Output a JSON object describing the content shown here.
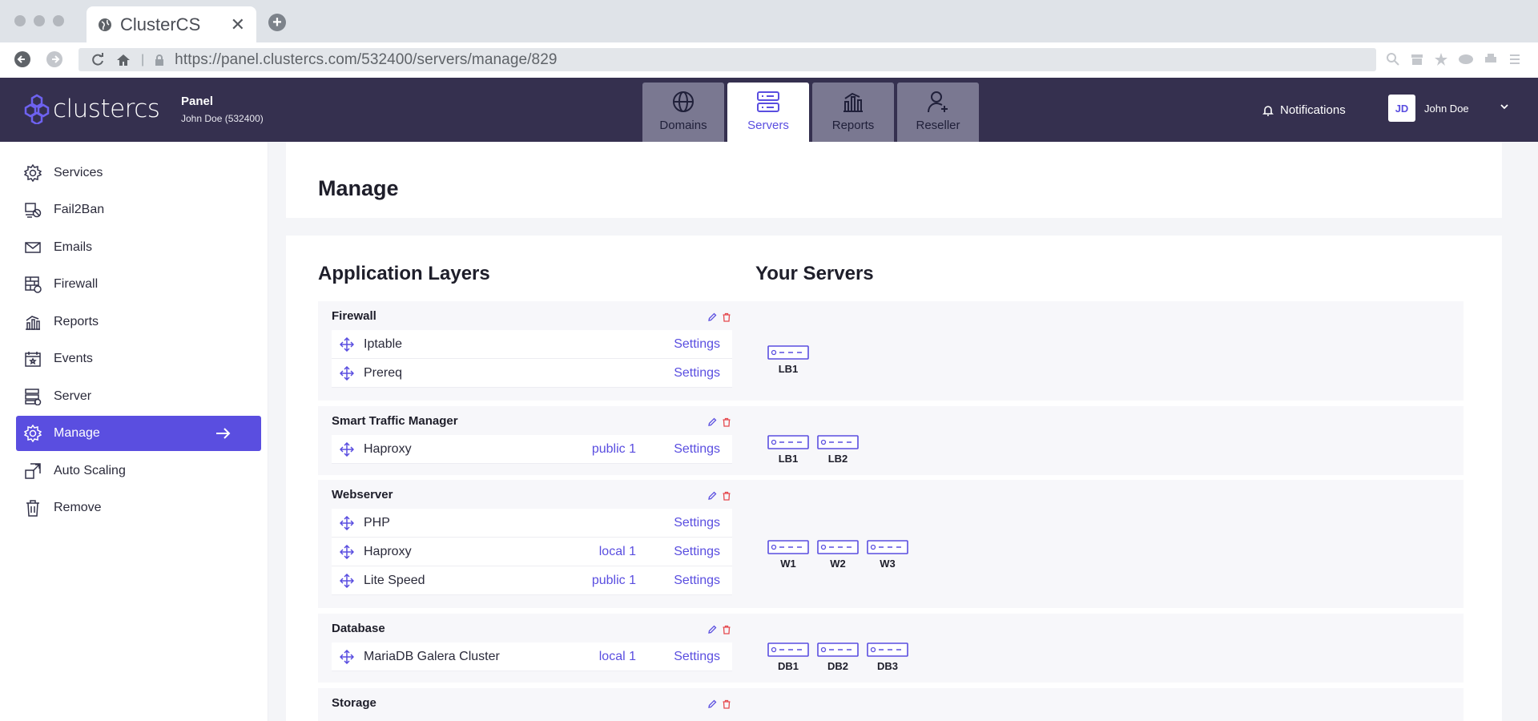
{
  "browser": {
    "tab_title": "ClusterCS",
    "url": "https://panel.clustercs.com/532400/servers/manage/829"
  },
  "header": {
    "logo_text": "clustercs",
    "panel_label": "Panel",
    "account": "John Doe (532400)",
    "tabs": [
      {
        "label": "Domains",
        "icon": "globe-icon"
      },
      {
        "label": "Servers",
        "icon": "servers-icon",
        "active": true
      },
      {
        "label": "Reports",
        "icon": "chart-icon"
      },
      {
        "label": "Reseller",
        "icon": "user-plus-icon"
      }
    ],
    "notifications_label": "Notifications",
    "user_initials": "JD",
    "user_name": "John Doe"
  },
  "sidebar": {
    "items": [
      {
        "label": "Services",
        "icon": "gear-icon"
      },
      {
        "label": "Fail2Ban",
        "icon": "ban-icon"
      },
      {
        "label": "Emails",
        "icon": "mail-icon"
      },
      {
        "label": "Firewall",
        "icon": "firewall-icon"
      },
      {
        "label": "Reports",
        "icon": "reports-icon"
      },
      {
        "label": "Events",
        "icon": "calendar-icon"
      },
      {
        "label": "Server",
        "icon": "server-icon"
      },
      {
        "label": "Manage",
        "icon": "gear-icon",
        "active": true
      },
      {
        "label": "Auto Scaling",
        "icon": "scale-icon"
      },
      {
        "label": "Remove",
        "icon": "trash-icon"
      }
    ]
  },
  "main": {
    "page_title": "Manage",
    "layers_heading": "Application Layers",
    "servers_heading": "Your Servers",
    "settings_label": "Settings",
    "layers": [
      {
        "title": "Firewall",
        "rows": [
          {
            "name": "Iptable",
            "net": ""
          },
          {
            "name": "Prereq",
            "net": ""
          }
        ],
        "servers": [
          "LB1"
        ]
      },
      {
        "title": "Smart Traffic Manager",
        "rows": [
          {
            "name": "Haproxy",
            "net": "public 1"
          }
        ],
        "servers": [
          "LB1",
          "LB2"
        ]
      },
      {
        "title": "Webserver",
        "rows": [
          {
            "name": "PHP",
            "net": ""
          },
          {
            "name": "Haproxy",
            "net": "local 1"
          },
          {
            "name": "Lite Speed",
            "net": "public 1"
          }
        ],
        "servers": [
          "W1",
          "W2",
          "W3"
        ]
      },
      {
        "title": "Database",
        "rows": [
          {
            "name": "MariaDB Galera Cluster",
            "net": "local 1"
          }
        ],
        "servers": [
          "DB1",
          "DB2",
          "DB3"
        ]
      },
      {
        "title": "Storage",
        "rows": [],
        "servers": []
      }
    ]
  },
  "colors": {
    "accent": "#5a4ee0",
    "header_bg": "#35304f",
    "danger": "#e5484d"
  }
}
